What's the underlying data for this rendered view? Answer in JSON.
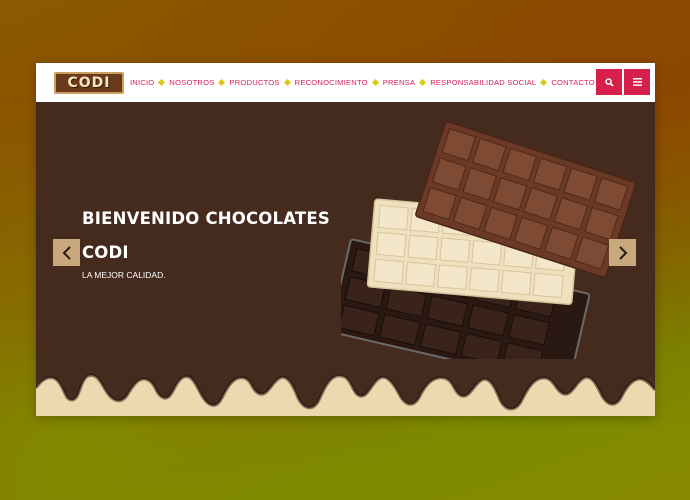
{
  "logo": {
    "text": "CODI"
  },
  "nav": {
    "items": [
      {
        "label": "INICIO"
      },
      {
        "label": "NOSOTROS"
      },
      {
        "label": "PRODUCTOS"
      },
      {
        "label": "RECONOCIMIENTO"
      },
      {
        "label": "PRENSA"
      },
      {
        "label": "RESPONSABILIDAD SOCIAL"
      },
      {
        "label": "CONTACTO"
      }
    ],
    "search_icon": "search-icon",
    "menu_icon": "hamburger-menu-icon"
  },
  "hero": {
    "title_line1": "BIENVENIDO CHOCOLATES",
    "title_line2": "CODI",
    "subtitle": "LA MEJOR CALIDAD.",
    "prev_icon": "chevron-left-icon",
    "next_icon": "chevron-right-icon"
  },
  "colors": {
    "accent": "#d61f4a",
    "nav_text": "#d61f55",
    "separator": "#d9c915",
    "hero_bg": "#452a1e",
    "cream": "#ecd9b0",
    "arrow_bg": "#c8a97e"
  }
}
